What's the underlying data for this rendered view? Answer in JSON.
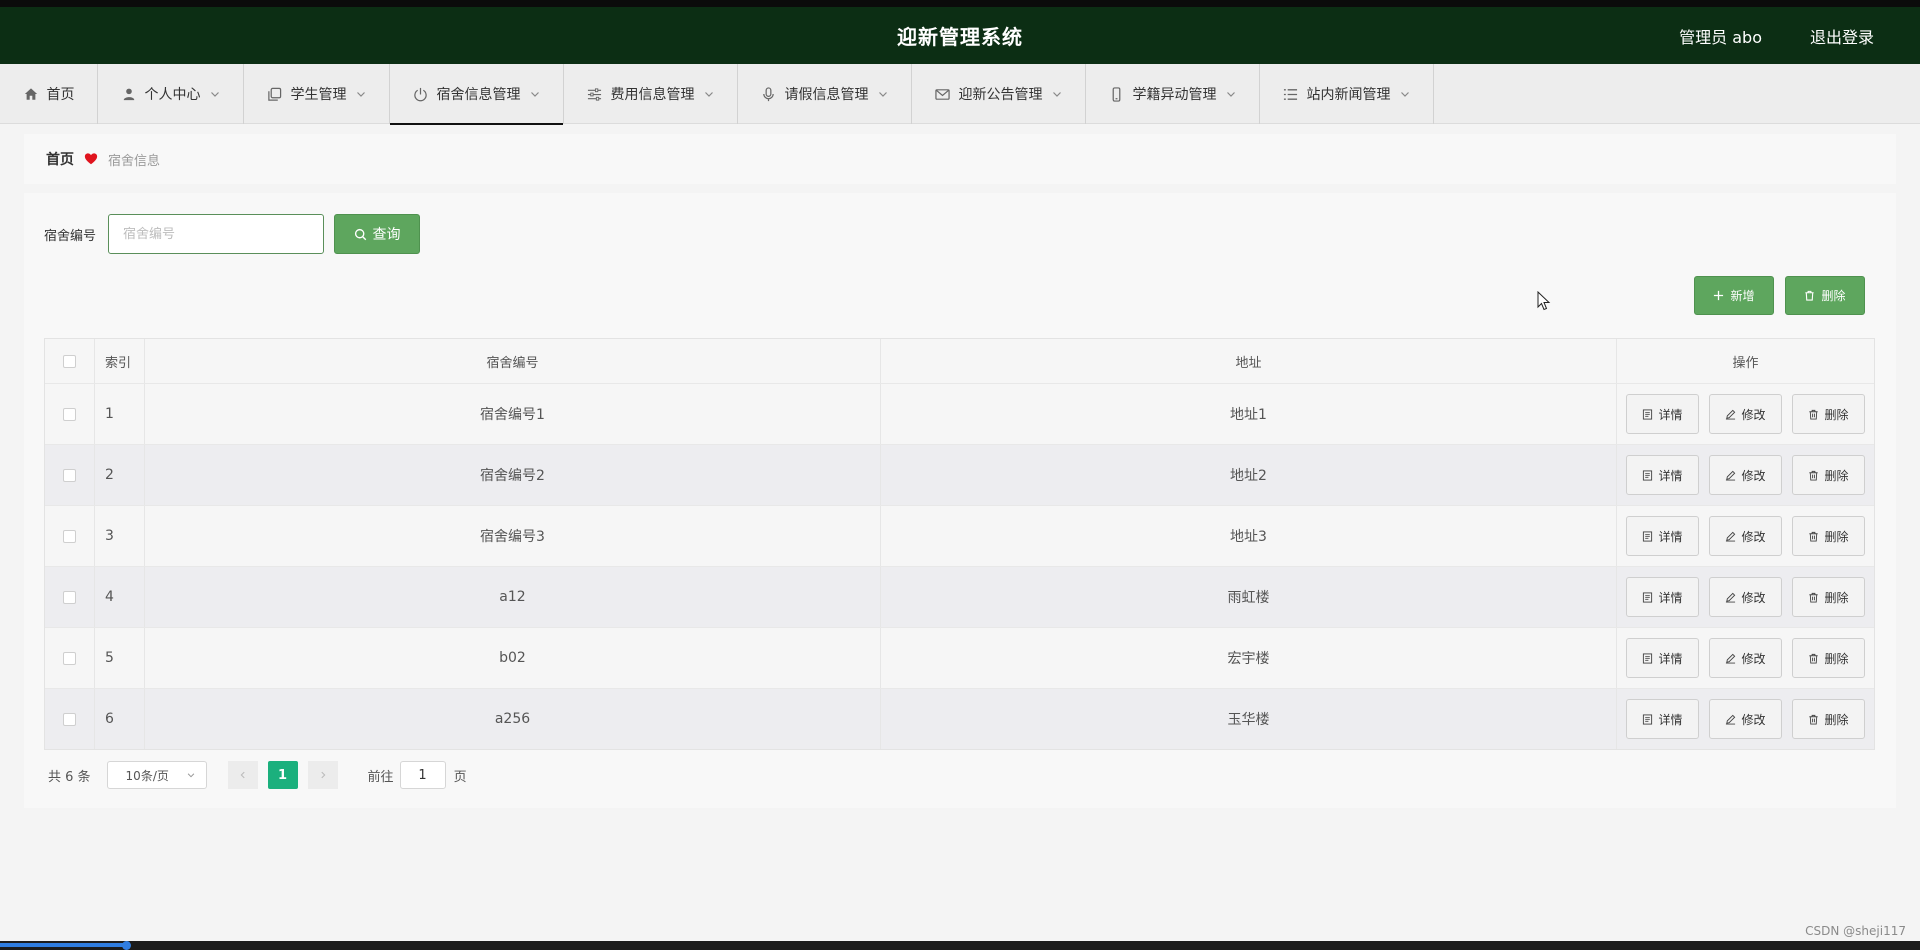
{
  "header": {
    "title": "迎新管理系统",
    "user": "管理员 abo",
    "logout": "退出登录"
  },
  "nav": {
    "items": [
      {
        "label": "首页",
        "icon": "home-icon"
      },
      {
        "label": "个人中心",
        "icon": "user-icon"
      },
      {
        "label": "学生管理",
        "icon": "copy-icon"
      },
      {
        "label": "宿舍信息管理",
        "icon": "power-icon"
      },
      {
        "label": "费用信息管理",
        "icon": "sliders-icon"
      },
      {
        "label": "请假信息管理",
        "icon": "microphone-icon"
      },
      {
        "label": "迎新公告管理",
        "icon": "mail-icon"
      },
      {
        "label": "学籍异动管理",
        "icon": "phone-icon"
      },
      {
        "label": "站内新闻管理",
        "icon": "list-icon"
      }
    ],
    "active": "宿舍信息管理"
  },
  "breadcrumb": {
    "home": "首页",
    "current": "宿舍信息"
  },
  "search": {
    "label": "宿舍编号",
    "placeholder": "宿舍编号",
    "value": "",
    "button": "查询"
  },
  "actions": {
    "add": "新增",
    "delete": "删除"
  },
  "table": {
    "headers": {
      "index": "索引",
      "number": "宿舍编号",
      "address": "地址",
      "ops": "操作"
    },
    "rows": [
      {
        "index": "1",
        "number": "宿舍编号1",
        "address": "地址1"
      },
      {
        "index": "2",
        "number": "宿舍编号2",
        "address": "地址2"
      },
      {
        "index": "3",
        "number": "宿舍编号3",
        "address": "地址3"
      },
      {
        "index": "4",
        "number": "a12",
        "address": "雨虹楼"
      },
      {
        "index": "5",
        "number": "b02",
        "address": "宏宇楼"
      },
      {
        "index": "6",
        "number": "a256",
        "address": "玉华楼"
      }
    ],
    "ops": {
      "detail": "详情",
      "edit": "修改",
      "delete": "删除"
    }
  },
  "pagination": {
    "total": "共 6 条",
    "page_size": "10条/页",
    "current_page": "1",
    "goto_prefix": "前往",
    "goto_value": "1",
    "goto_suffix": "页"
  },
  "watermark": "CSDN @sheji117",
  "colors": {
    "header_bg": "#0c2e14",
    "primary_green": "#5ea65e",
    "page_active": "#1bb07d",
    "heart": "#e0141e"
  }
}
